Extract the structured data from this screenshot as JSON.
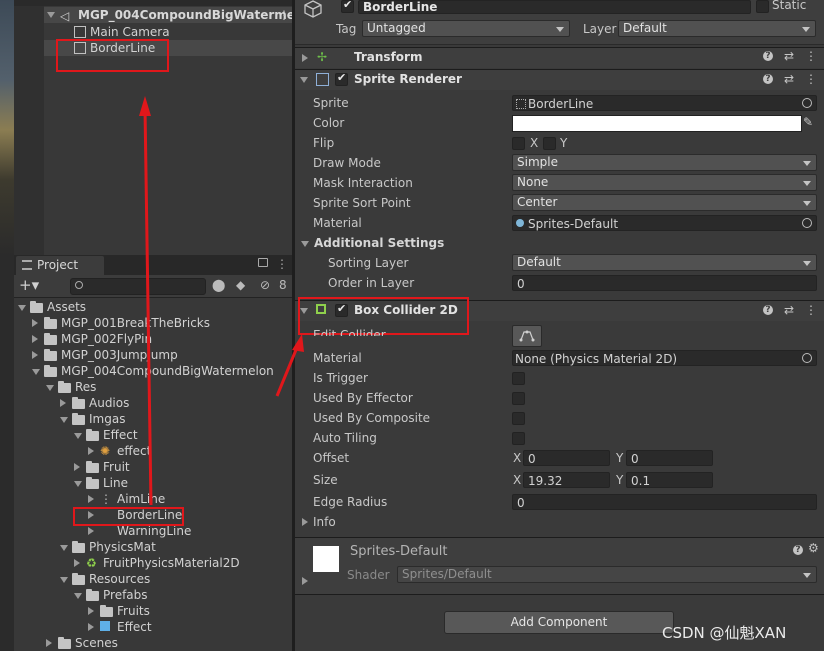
{
  "hierarchy": {
    "scene_name": "MGP_004CompoundBigWaterme",
    "items": [
      "Main Camera",
      "BorderLine"
    ]
  },
  "project": {
    "tab_label": "Project",
    "badge_count": "8",
    "tree": [
      {
        "label": "Assets",
        "depth": 0,
        "open": true,
        "folder": true
      },
      {
        "label": "MGP_001BreakTheBricks",
        "depth": 1,
        "open": false,
        "folder": true
      },
      {
        "label": "MGP_002FlyPin",
        "depth": 1,
        "open": false,
        "folder": true
      },
      {
        "label": "MGP_003JumpJump",
        "depth": 1,
        "open": false,
        "folder": true
      },
      {
        "label": "MGP_004CompoundBigWatermelon",
        "depth": 1,
        "open": true,
        "folder": true
      },
      {
        "label": "Res",
        "depth": 2,
        "open": true,
        "folder": true
      },
      {
        "label": "Audios",
        "depth": 3,
        "open": false,
        "folder": true
      },
      {
        "label": "Imgas",
        "depth": 3,
        "open": true,
        "folder": true
      },
      {
        "label": "Effect",
        "depth": 4,
        "open": true,
        "folder": true
      },
      {
        "label": "effect",
        "depth": 5,
        "open": false,
        "folder": false,
        "icon": "sparkle"
      },
      {
        "label": "Fruit",
        "depth": 4,
        "open": false,
        "folder": true
      },
      {
        "label": "Line",
        "depth": 4,
        "open": true,
        "folder": true
      },
      {
        "label": "AimLine",
        "depth": 5,
        "open": false,
        "folder": false,
        "icon": "dots"
      },
      {
        "label": "BorderLine",
        "depth": 5,
        "open": false,
        "folder": false,
        "icon": "none"
      },
      {
        "label": "WarningLine",
        "depth": 5,
        "open": false,
        "folder": false,
        "icon": "none"
      },
      {
        "label": "PhysicsMat",
        "depth": 3,
        "open": true,
        "folder": true
      },
      {
        "label": "FruitPhysicsMaterial2D",
        "depth": 4,
        "open": false,
        "folder": false,
        "icon": "physmat"
      },
      {
        "label": "Resources",
        "depth": 3,
        "open": true,
        "folder": true
      },
      {
        "label": "Prefabs",
        "depth": 4,
        "open": true,
        "folder": true
      },
      {
        "label": "Fruits",
        "depth": 5,
        "open": false,
        "folder": true
      },
      {
        "label": "Effect",
        "depth": 5,
        "open": false,
        "folder": false,
        "icon": "cube-blue"
      },
      {
        "label": "Scenes",
        "depth": 2,
        "open": false,
        "folder": true
      }
    ]
  },
  "inspector": {
    "object_name": "BorderLine",
    "static_label": "Static",
    "tag_label": "Tag",
    "tag_value": "Untagged",
    "layer_label": "Layer",
    "layer_value": "Default",
    "transform_title": "Transform",
    "sprite_renderer": {
      "title": "Sprite Renderer",
      "sprite_label": "Sprite",
      "sprite_value": "BorderLine",
      "color_label": "Color",
      "flip_label": "Flip",
      "flip_x": "X",
      "flip_y": "Y",
      "draw_mode_label": "Draw Mode",
      "draw_mode_value": "Simple",
      "mask_label": "Mask Interaction",
      "mask_value": "None",
      "sort_point_label": "Sprite Sort Point",
      "sort_point_value": "Center",
      "material_label": "Material",
      "material_value": "Sprites-Default",
      "additional_label": "Additional Settings",
      "sorting_layer_label": "Sorting Layer",
      "sorting_layer_value": "Default",
      "order_label": "Order in Layer",
      "order_value": "0"
    },
    "box_collider": {
      "title": "Box Collider 2D",
      "edit_label": "Edit Collider",
      "material_label": "Material",
      "material_value": "None (Physics Material 2D)",
      "is_trigger_label": "Is Trigger",
      "used_effector_label": "Used By Effector",
      "used_composite_label": "Used By Composite",
      "auto_tiling_label": "Auto Tiling",
      "offset_label": "Offset",
      "offset_x": "0",
      "offset_y": "0",
      "size_label": "Size",
      "size_x": "19.32",
      "size_y": "0.1",
      "edge_radius_label": "Edge Radius",
      "edge_radius_value": "0",
      "info_label": "Info",
      "axis_x": "X",
      "axis_y": "Y"
    },
    "material_preview": {
      "name": "Sprites-Default",
      "shader_label": "Shader",
      "shader_value": "Sprites/Default"
    },
    "add_component_label": "Add Component"
  },
  "watermark": "CSDN @仙魁XAN",
  "colors": {
    "annotation_red": "#e0171b",
    "selection": "#4d4d4d"
  }
}
